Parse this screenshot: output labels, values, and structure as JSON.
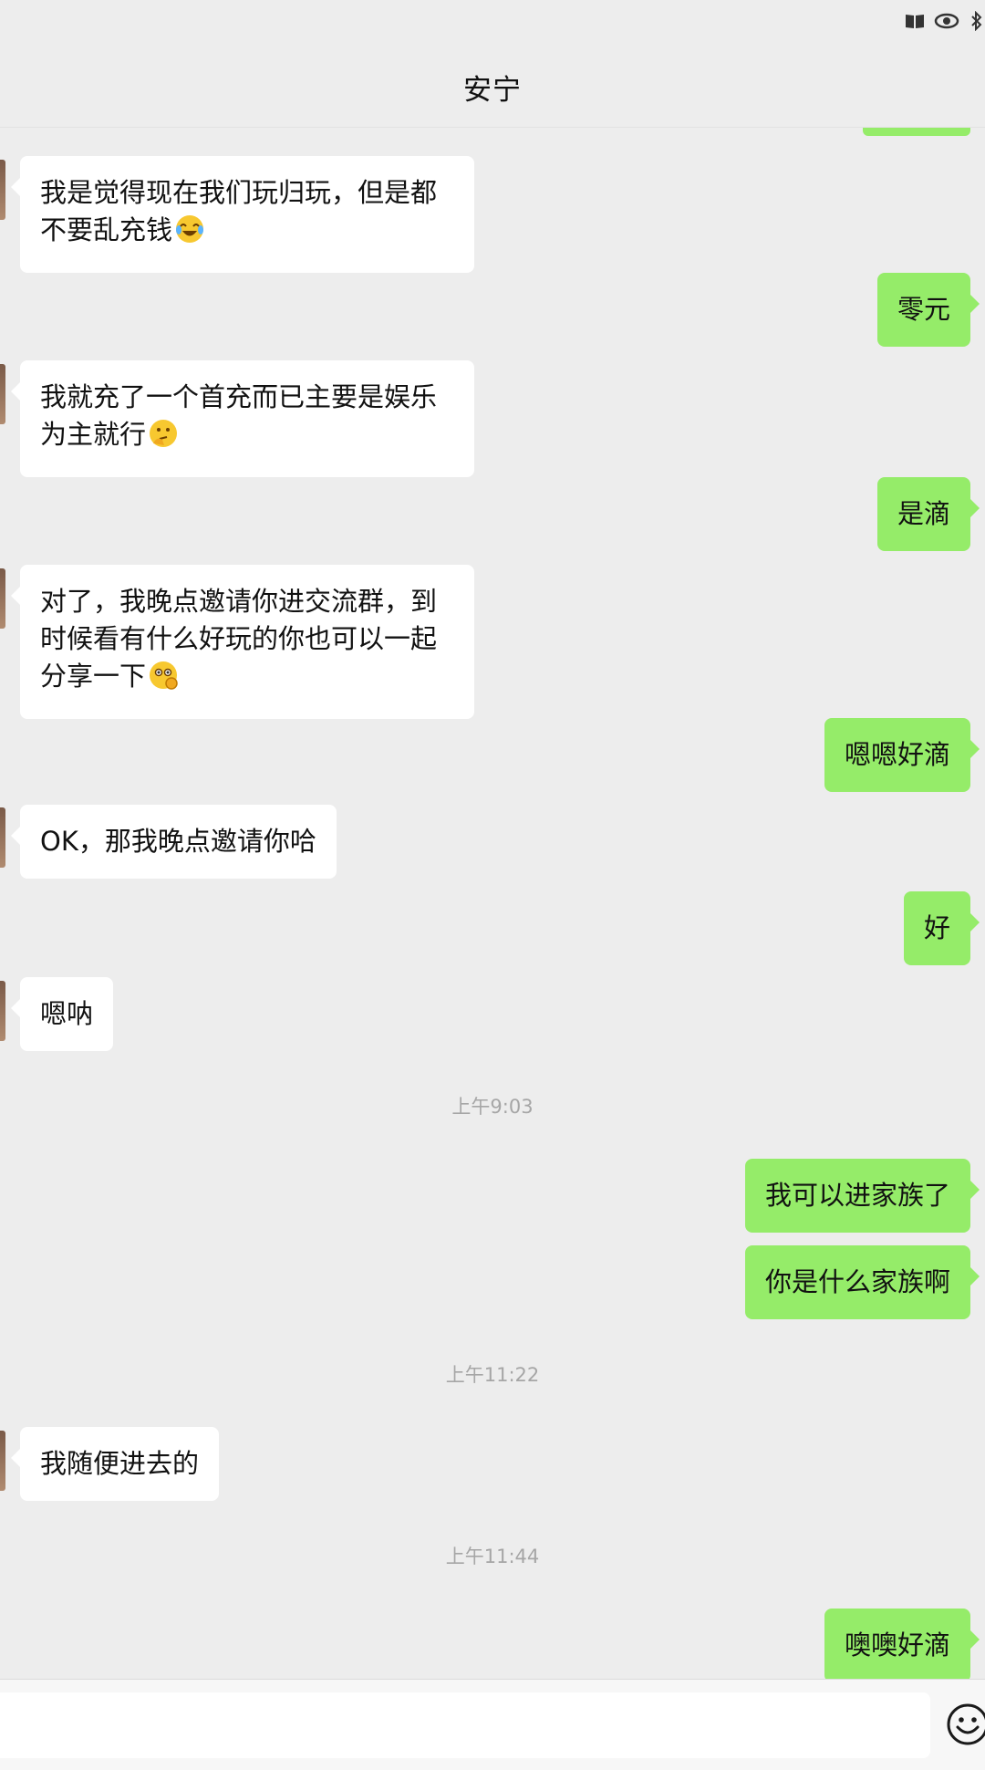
{
  "header": {
    "title": "安宁"
  },
  "messages": [
    {
      "side": "in",
      "text": "我是觉得现在我们玩归玩，但是都不要乱充钱",
      "emoji": "tears-of-joy-emoji"
    },
    {
      "side": "out",
      "text": "零元"
    },
    {
      "side": "in",
      "text": "我就充了一个首充而已主要是娱乐为主就行",
      "emoji": "thinking-emoji"
    },
    {
      "side": "out",
      "text": "是滴"
    },
    {
      "side": "in",
      "text": "对了，我晚点邀请你进交流群，到时候看有什么好玩的你也可以一起分享一下",
      "emoji": "ok-hand-emoji"
    },
    {
      "side": "out",
      "text": "嗯嗯好滴"
    },
    {
      "side": "in",
      "text": "OK，那我晚点邀请你哈"
    },
    {
      "side": "out",
      "text": "好"
    },
    {
      "side": "in",
      "text": "嗯呐"
    },
    {
      "side": "out",
      "text": "我可以进家族了"
    },
    {
      "side": "out",
      "text": "你是什么家族啊"
    },
    {
      "side": "in",
      "text": "我随便进去的"
    },
    {
      "side": "out",
      "text": "噢噢好滴"
    }
  ],
  "timestamps": [
    "上午9:03",
    "上午11:22",
    "上午11:44"
  ],
  "input": {
    "placeholder": ""
  },
  "icons": {
    "status": [
      "book-icon",
      "eye-icon",
      "bluetooth-icon"
    ],
    "input_bar": [
      "emoji-icon"
    ]
  },
  "colors": {
    "background": "#ededed",
    "incoming_bubble": "#ffffff",
    "outgoing_bubble": "#95ec69",
    "timestamp_text": "#a6a6a6"
  }
}
